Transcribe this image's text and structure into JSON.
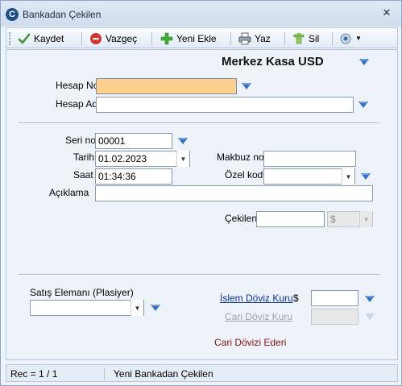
{
  "window": {
    "title": "Bankadan Çekilen",
    "close_glyph": "✕"
  },
  "toolbar": {
    "kaydet": "Kaydet",
    "vazgec": "Vazgeç",
    "yeni_ekle": "Yeni Ekle",
    "yaz": "Yaz",
    "sil": "Sil"
  },
  "header": {
    "kasa": "Merkez Kasa USD"
  },
  "form": {
    "hesap_no_label": "Hesap No",
    "hesap_no_value": "",
    "hesap_adi_label": "Hesap Adı",
    "hesap_adi_value": "",
    "seri_no_label": "Seri no",
    "seri_no_value": "00001",
    "tarih_label": "Tarih",
    "tarih_value": "01.02.2023",
    "saat_label": "Saat",
    "saat_value": "01:34:36",
    "makbuz_no_label": "Makbuz no",
    "makbuz_no_value": "",
    "ozel_kod_label": "Özel kod",
    "ozel_kod_value": "",
    "aciklama_label": "Açıklama",
    "aciklama_value": "",
    "cekilen_label": "Çekilen",
    "cekilen_value": "",
    "currency_value": "$"
  },
  "bottom": {
    "satis_elemani_label": "Satış Elemanı (Plasiyer)",
    "satis_elemani_value": "",
    "islem_doviz_kuru_label": "İslem Döviz Kuru",
    "islem_doviz_symbol": "$",
    "islem_doviz_value": "",
    "cari_doviz_kuru_label": "Cari Döviz Kuru",
    "cari_doviz_value": "",
    "cari_dovizi_ederi": "Cari Dövizi Ederi"
  },
  "status": {
    "rec": "Rec = 1 / 1",
    "message": "Yeni Bankadan Çekilen"
  },
  "colors": {
    "accent_triangle": "#2f6fce",
    "focus_field": "#fdd08f",
    "link": "#0b2fa8",
    "red_text": "#8b1010"
  }
}
